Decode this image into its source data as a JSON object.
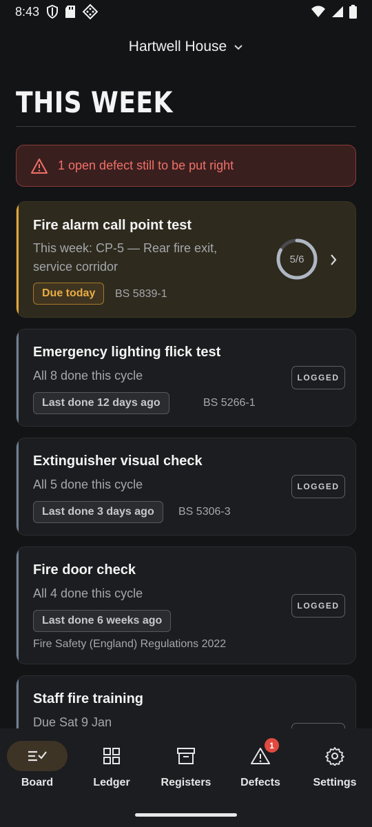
{
  "status_bar": {
    "time": "8:43"
  },
  "header": {
    "site_name": "Hartwell House"
  },
  "page_title": "THIS WEEK",
  "alert": {
    "text": "1 open defect still to be put right"
  },
  "cards": [
    {
      "title": "Fire alarm call point test",
      "subtitle_line1": "This week: CP-5 — Rear fire exit,",
      "subtitle_line2": "service corridor",
      "chip": "Due today",
      "standard": "BS 5839-1",
      "progress_text": "5/6",
      "progress": 0.83
    },
    {
      "title": "Emergency lighting flick test",
      "subtitle": "All 8 done this cycle",
      "chip": "Last done 12 days ago",
      "standard": "BS 5266-1",
      "status": "LOGGED"
    },
    {
      "title": "Extinguisher visual check",
      "subtitle": "All 5 done this cycle",
      "chip": "Last done 3 days ago",
      "standard": "BS 5306-3",
      "status": "LOGGED"
    },
    {
      "title": "Fire door check",
      "subtitle": "All 4 done this cycle",
      "chip": "Last done 6 weeks ago",
      "standard": "Fire Safety (England) Regulations 2022",
      "status": "LOGGED"
    },
    {
      "title": "Staff fire training",
      "subtitle": "Due Sat 9 Jan"
    }
  ],
  "nav": {
    "items": [
      {
        "label": "Board",
        "icon": "board-icon",
        "active": true
      },
      {
        "label": "Ledger",
        "icon": "grid-icon"
      },
      {
        "label": "Registers",
        "icon": "archive-icon"
      },
      {
        "label": "Defects",
        "icon": "warning-icon",
        "badge": "1"
      },
      {
        "label": "Settings",
        "icon": "gear-icon"
      }
    ]
  },
  "colors": {
    "background": "#131416",
    "accent_due": "#e0a63b",
    "alert_red": "#f07168",
    "badge_red": "#e04a3f"
  }
}
